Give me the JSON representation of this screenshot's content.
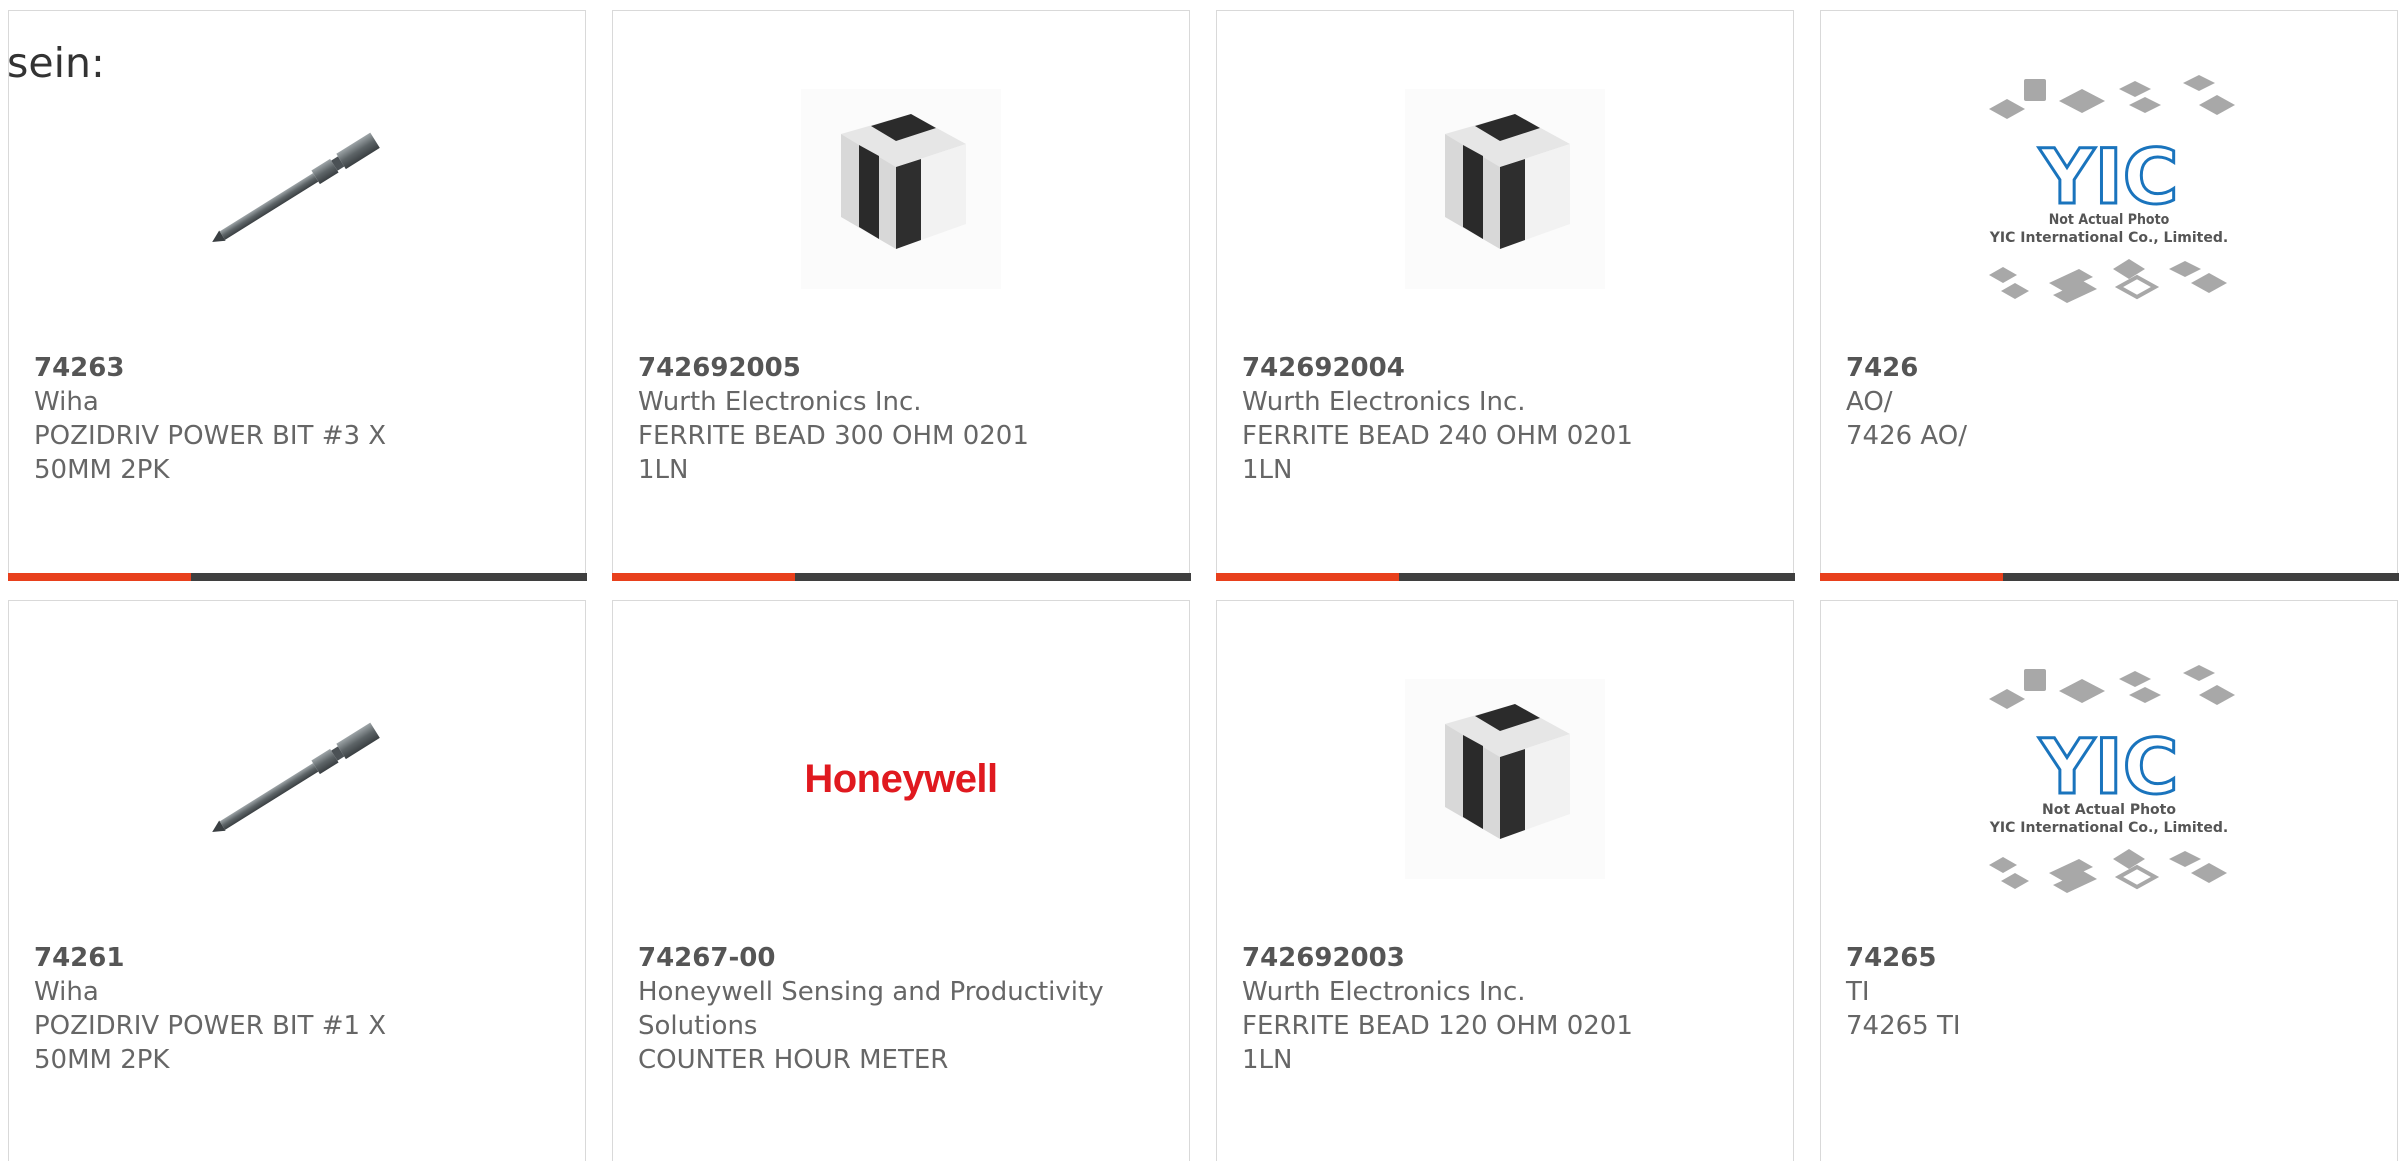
{
  "intro_text": "sein:",
  "colors": {
    "accent": "#e8401c",
    "bar": "#3f3f3f",
    "border": "#d9d9d9",
    "honeywell": "#e0191f"
  },
  "products": [
    {
      "part": "74263",
      "manufacturer": "Wiha",
      "description": "POZIDRIV POWER BIT #3 X 50MM 2PK",
      "image": "screwdriver-bit-image"
    },
    {
      "part": "742692005",
      "manufacturer": "Wurth Electronics Inc.",
      "description": "FERRITE BEAD 300 OHM 0201 1LN",
      "image": "ferrite-bead-image"
    },
    {
      "part": "742692004",
      "manufacturer": "Wurth Electronics Inc.",
      "description": "FERRITE BEAD 240 OHM 0201 1LN",
      "image": "ferrite-bead-image"
    },
    {
      "part": "7426",
      "manufacturer": "AO/",
      "description": "7426 AO/",
      "image": "yic-placeholder-image",
      "image_text": [
        "Not Actual Photo",
        "YIC International Co., Limited."
      ]
    },
    {
      "part": "74261",
      "manufacturer": "Wiha",
      "description": "POZIDRIV POWER BIT #1 X 50MM 2PK",
      "image": "screwdriver-bit-image"
    },
    {
      "part": "74267-00",
      "manufacturer": "Honeywell Sensing and Productivity Solutions",
      "description": "COUNTER HOUR METER",
      "image": "honeywell-logo",
      "image_text": [
        "Honeywell"
      ]
    },
    {
      "part": "742692003",
      "manufacturer": "Wurth Electronics Inc.",
      "description": "FERRITE BEAD 120 OHM 0201 1LN",
      "image": "ferrite-bead-image"
    },
    {
      "part": "74265",
      "manufacturer": "TI",
      "description": "74265 TI",
      "image": "yic-placeholder-image",
      "image_text": [
        "Not Actual Photo",
        "YIC International Co., Limited."
      ]
    }
  ]
}
